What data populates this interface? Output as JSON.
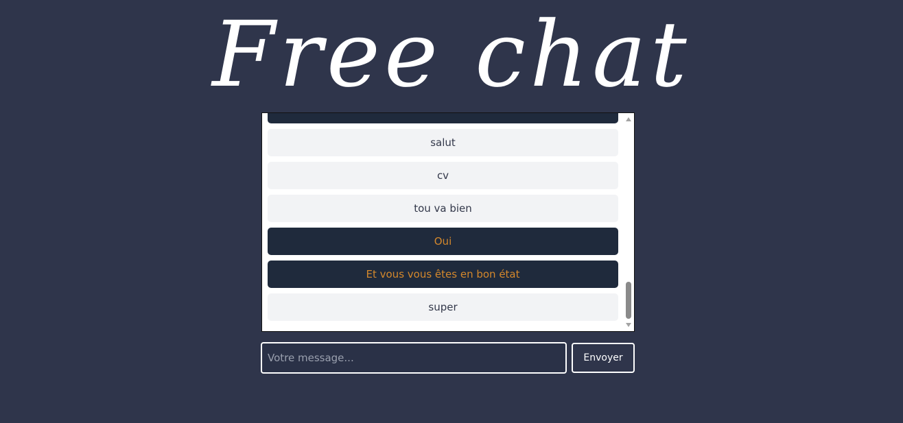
{
  "app": {
    "title": "Free chat"
  },
  "chat": {
    "messages": [
      {
        "text": "",
        "sender": "mine"
      },
      {
        "text": "salut",
        "sender": "other"
      },
      {
        "text": "cv",
        "sender": "other"
      },
      {
        "text": "tou va bien",
        "sender": "other"
      },
      {
        "text": "Oui",
        "sender": "mine"
      },
      {
        "text": "Et vous vous êtes en bon état",
        "sender": "mine"
      },
      {
        "text": "super",
        "sender": "other"
      }
    ]
  },
  "composer": {
    "placeholder": "Votre message...",
    "value": "",
    "send_label": "Envoyer"
  },
  "colors": {
    "background": "#2f354b",
    "mine_bubble": "#1f2a3c",
    "mine_text": "#d4882c",
    "other_bubble": "#f2f3f5",
    "other_text": "#33384a"
  }
}
